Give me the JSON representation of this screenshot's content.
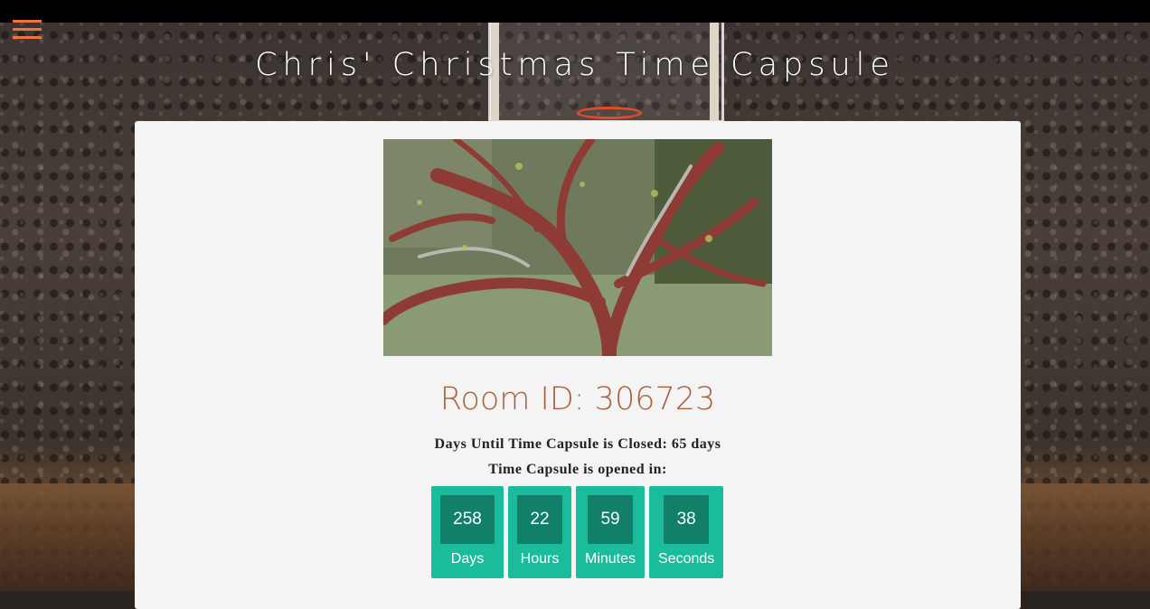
{
  "header": {
    "title": "Chris' Christmas Time Capsule",
    "menu_icon": "hamburger-menu-icon"
  },
  "room": {
    "id_text": "Room ID: 306723",
    "closing_text": "Days Until Time Capsule is Closed: 65 days",
    "opened_in_text": "Time Capsule is opened in:"
  },
  "countdown": [
    {
      "value": "258",
      "label": "Days"
    },
    {
      "value": "22",
      "label": "Hours"
    },
    {
      "value": "59",
      "label": "Minutes"
    },
    {
      "value": "38",
      "label": "Seconds"
    }
  ],
  "colors": {
    "accent_menu": "#f0733a",
    "room_id": "#a9623f",
    "countdown_box": "#1abc9c",
    "countdown_inner": "#127f68"
  }
}
